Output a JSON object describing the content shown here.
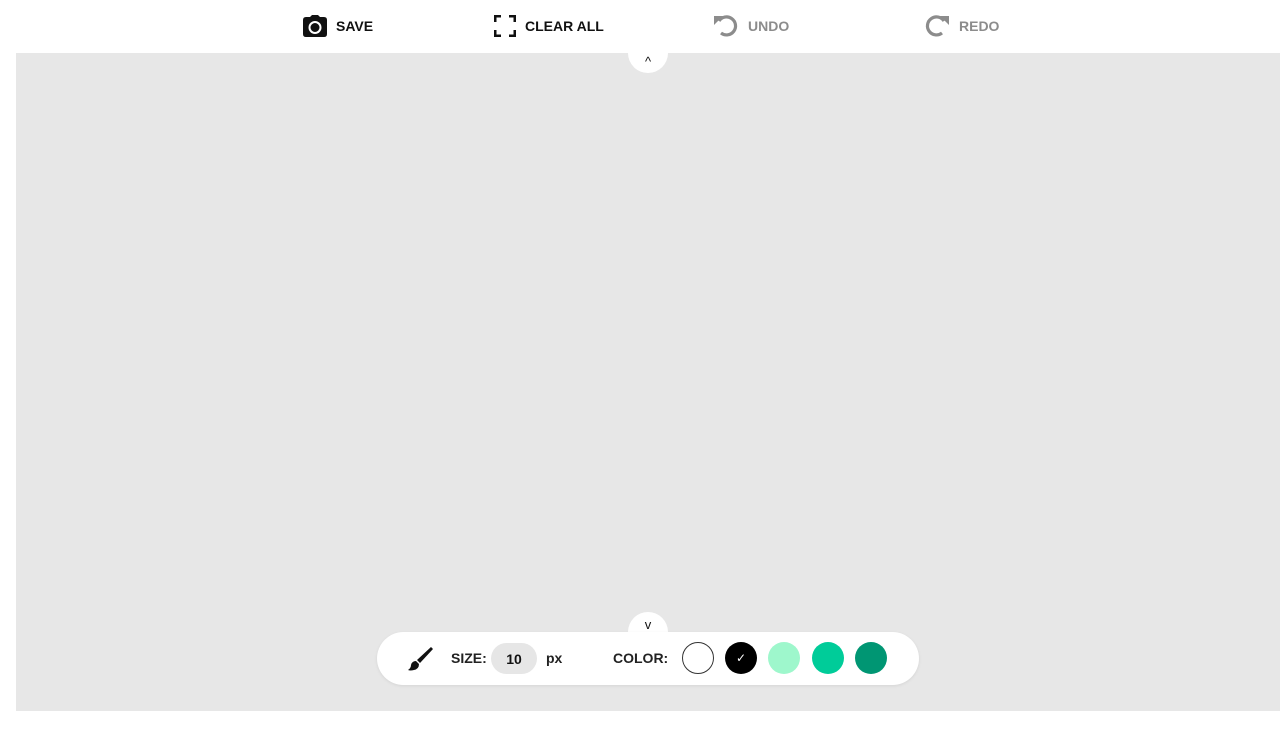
{
  "toolbar": {
    "save_label": "SAVE",
    "clear_label": "CLEAR ALL",
    "undo_label": "UNDO",
    "redo_label": "REDO"
  },
  "canvas": {
    "collapse_top_glyph": "^",
    "collapse_bottom_glyph": "v",
    "background_color": "#e7e7e7"
  },
  "brush": {
    "size_label": "SIZE:",
    "size_value": "10",
    "unit_label": "px",
    "color_label": "COLOR:",
    "selected_check": "✓",
    "colors": [
      {
        "name": "white",
        "hex": "#ffffff"
      },
      {
        "name": "black",
        "hex": "#000000",
        "selected": true
      },
      {
        "name": "mint",
        "hex": "#9ef7cc"
      },
      {
        "name": "green",
        "hex": "#00cc99"
      },
      {
        "name": "dark-green",
        "hex": "#009673"
      }
    ]
  }
}
